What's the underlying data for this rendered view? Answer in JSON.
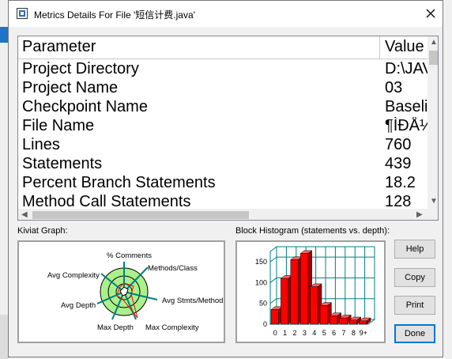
{
  "window": {
    "title": "Metrics Details For File '短信计费.java'"
  },
  "table": {
    "columns": [
      "Parameter",
      "Value"
    ],
    "rows": [
      {
        "parameter": "Project Directory",
        "value": "D:\\JAV"
      },
      {
        "parameter": "Project Name",
        "value": "03"
      },
      {
        "parameter": "Checkpoint Name",
        "value": "Baseli"
      },
      {
        "parameter": "File Name",
        "value": "¶ÌÐÅ¼"
      },
      {
        "parameter": "Lines",
        "value": "760"
      },
      {
        "parameter": "Statements",
        "value": "439"
      },
      {
        "parameter": "Percent Branch Statements",
        "value": "18.2"
      },
      {
        "parameter": "Method Call Statements",
        "value": "128"
      }
    ]
  },
  "kiviat": {
    "label": "Kiviat Graph:",
    "axes": [
      "% Comments",
      "Methods/Class",
      "Avg Stmts/Method",
      "Max Complexity",
      "Max Depth",
      "Avg Depth",
      "Avg Complexity"
    ]
  },
  "histogram": {
    "label": "Block Histogram (statements vs. depth):"
  },
  "buttons": {
    "help": "Help",
    "copy": "Copy",
    "print": "Print",
    "done": "Done"
  },
  "chart_data": {
    "type": "bar",
    "title": "Block Histogram (statements vs. depth):",
    "categories": [
      "0",
      "1",
      "2",
      "3",
      "4",
      "5",
      "6",
      "7",
      "8",
      "9+"
    ],
    "values": [
      35,
      110,
      155,
      170,
      90,
      45,
      20,
      15,
      10,
      8
    ],
    "ylim": [
      0,
      175
    ],
    "yticks": [
      "150",
      "100",
      "50",
      "0"
    ],
    "colors": {
      "bar": "#ff0000",
      "grid": "#008080"
    }
  }
}
